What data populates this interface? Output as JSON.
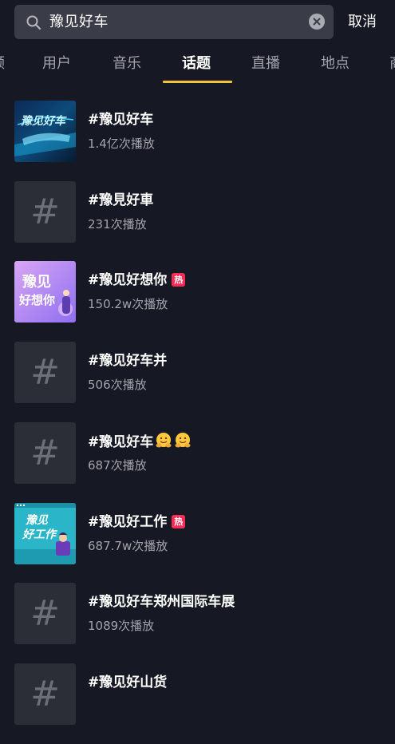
{
  "search": {
    "query": "豫见好车",
    "cancel_label": "取消"
  },
  "tabs": [
    {
      "label": "频"
    },
    {
      "label": "用户"
    },
    {
      "label": "音乐"
    },
    {
      "label": "话题"
    },
    {
      "label": "直播"
    },
    {
      "label": "地点"
    },
    {
      "label": "商"
    }
  ],
  "active_tab": "话题",
  "hot_label": "热",
  "colors": {
    "background": "#161823",
    "accent_underline": "#f5c03a",
    "hot_badge": "#fe2c55"
  },
  "results": [
    {
      "title": "#豫见好车",
      "plays": "1.4亿次播放",
      "thumb": "image",
      "hot": false
    },
    {
      "title": "#豫見好車",
      "plays": "231次播放",
      "thumb": "hash-icon",
      "hot": false
    },
    {
      "title": "#豫见好想你",
      "plays": "150.2w次播放",
      "thumb": "image",
      "hot": true
    },
    {
      "title": "#豫见好车并",
      "plays": "506次播放",
      "thumb": "hash-icon",
      "hot": false
    },
    {
      "title": "#豫见好车",
      "plays": "687次播放",
      "thumb": "hash-icon",
      "hot": false,
      "emoji": "hugging-face-emoji x2"
    },
    {
      "title": "#豫见好工作",
      "plays": "687.7w次播放",
      "thumb": "image",
      "hot": true
    },
    {
      "title": "#豫见好车郑州国际车展",
      "plays": "1089次播放",
      "thumb": "hash-icon",
      "hot": false
    },
    {
      "title": "#豫见好山货",
      "plays": "",
      "thumb": "hash-icon",
      "hot": false
    }
  ],
  "thumb_texts": {
    "item3": [
      "豫见",
      "好想你"
    ],
    "item6": [
      "豫见",
      "好工作"
    ]
  }
}
